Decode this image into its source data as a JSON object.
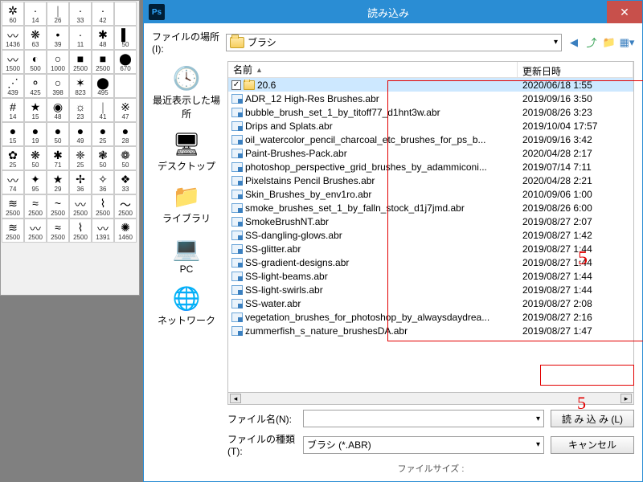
{
  "brush_palette": {
    "cells": [
      {
        "n": "60",
        "g": "✲"
      },
      {
        "n": "14",
        "g": "·"
      },
      {
        "n": "26",
        "g": "｜"
      },
      {
        "n": "33",
        "g": "·"
      },
      {
        "n": "42",
        "g": "·"
      },
      {
        "n": ""
      },
      {
        "n": "1436",
        "g": "〰"
      },
      {
        "n": "63",
        "g": "❋"
      },
      {
        "n": "39",
        "g": "•"
      },
      {
        "n": "11",
        "g": "·"
      },
      {
        "n": "48",
        "g": "✱"
      },
      {
        "n": "50",
        "g": "▌"
      },
      {
        "n": "1500",
        "g": "〰"
      },
      {
        "n": "500",
        "g": "◐"
      },
      {
        "n": "1000",
        "g": "○"
      },
      {
        "n": "2500",
        "g": "■"
      },
      {
        "n": "2500",
        "g": "■"
      },
      {
        "n": "670",
        "g": "⬤"
      },
      {
        "n": "439",
        "g": "⋰"
      },
      {
        "n": "425",
        "g": "⚬"
      },
      {
        "n": "398",
        "g": "○"
      },
      {
        "n": "823",
        "g": "✶"
      },
      {
        "n": "495",
        "g": "⬤"
      },
      {
        "n": ""
      },
      {
        "n": "14",
        "g": "#"
      },
      {
        "n": "15",
        "g": "★"
      },
      {
        "n": "48",
        "g": "◉"
      },
      {
        "n": "23",
        "g": "☼"
      },
      {
        "n": "41",
        "g": "｜"
      },
      {
        "n": "47",
        "g": "※"
      },
      {
        "n": "15",
        "g": "●"
      },
      {
        "n": "19",
        "g": "●"
      },
      {
        "n": "50",
        "g": "●"
      },
      {
        "n": "49",
        "g": "●"
      },
      {
        "n": "25",
        "g": "●"
      },
      {
        "n": "28",
        "g": "●"
      },
      {
        "n": "25",
        "g": "✿"
      },
      {
        "n": "50",
        "g": "❋"
      },
      {
        "n": "71",
        "g": "✱"
      },
      {
        "n": "25",
        "g": "❈"
      },
      {
        "n": "50",
        "g": "❃"
      },
      {
        "n": "50",
        "g": "❁"
      },
      {
        "n": "74",
        "g": "〰"
      },
      {
        "n": "95",
        "g": "✦"
      },
      {
        "n": "29",
        "g": "★"
      },
      {
        "n": "36",
        "g": "✢"
      },
      {
        "n": "36",
        "g": "✧"
      },
      {
        "n": "33",
        "g": "❖"
      },
      {
        "n": "2500",
        "g": "≋"
      },
      {
        "n": "2500",
        "g": "≈"
      },
      {
        "n": "2500",
        "g": "~"
      },
      {
        "n": "2500",
        "g": "〰"
      },
      {
        "n": "2500",
        "g": "⌇"
      },
      {
        "n": "2500",
        "g": "〜"
      },
      {
        "n": "2500",
        "g": "≋"
      },
      {
        "n": "2500",
        "g": "〰"
      },
      {
        "n": "2500",
        "g": "≈"
      },
      {
        "n": "2500",
        "g": "⌇"
      },
      {
        "n": "1391",
        "g": "〰"
      },
      {
        "n": "1460",
        "g": "✺"
      }
    ]
  },
  "dialog": {
    "title": "読み込み",
    "location_label": "ファイルの場所(I):",
    "location_value": "ブラシ",
    "places": [
      {
        "label": "最近表示した場所",
        "icon": "🕓"
      },
      {
        "label": "デスクトップ",
        "icon": "🖥"
      },
      {
        "label": "ライブラリ",
        "icon": "📁"
      },
      {
        "label": "PC",
        "icon": "💻"
      },
      {
        "label": "ネットワーク",
        "icon": "🌐"
      }
    ],
    "headers": {
      "name": "名前",
      "date": "更新日時"
    },
    "files": [
      {
        "type": "folder",
        "checked": true,
        "name": "20.6",
        "date": "2020/06/18 1:55",
        "selected": true
      },
      {
        "type": "abr",
        "name": "ADR_12 High-Res Brushes.abr",
        "date": "2019/09/16 3:50"
      },
      {
        "type": "abr",
        "name": "bubble_brush_set_1_by_titoff77_d1hnt3w.abr",
        "date": "2019/08/26 3:23"
      },
      {
        "type": "abr",
        "name": "Drips and Splats.abr",
        "date": "2019/10/04 17:57"
      },
      {
        "type": "abr",
        "name": "oil_watercolor_pencil_charcoal_etc_brushes_for_ps_b...",
        "date": "2019/09/16 3:42"
      },
      {
        "type": "abr",
        "name": "Paint-Brushes-Pack.abr",
        "date": "2020/04/28 2:17"
      },
      {
        "type": "abr",
        "name": "photoshop_perspective_grid_brushes_by_adammiconi...",
        "date": "2019/07/14 7:11"
      },
      {
        "type": "abr",
        "name": "Pixelstains Pencil Brushes.abr",
        "date": "2020/04/28 2:21"
      },
      {
        "type": "abr",
        "name": "Skin_Brushes_by_env1ro.abr",
        "date": "2010/09/06 1:00"
      },
      {
        "type": "abr",
        "name": "smoke_brushes_set_1_by_falln_stock_d1j7jmd.abr",
        "date": "2019/08/26 6:00"
      },
      {
        "type": "abr",
        "name": "SmokeBrushNT.abr",
        "date": "2019/08/27 2:07"
      },
      {
        "type": "abr",
        "name": "SS-dangling-glows.abr",
        "date": "2019/08/27 1:42"
      },
      {
        "type": "abr",
        "name": "SS-glitter.abr",
        "date": "2019/08/27 1:44"
      },
      {
        "type": "abr",
        "name": "SS-gradient-designs.abr",
        "date": "2019/08/27 1:44"
      },
      {
        "type": "abr",
        "name": "SS-light-beams.abr",
        "date": "2019/08/27 1:44"
      },
      {
        "type": "abr",
        "name": "SS-light-swirls.abr",
        "date": "2019/08/27 1:44"
      },
      {
        "type": "abr",
        "name": "SS-water.abr",
        "date": "2019/08/27 2:08"
      },
      {
        "type": "abr",
        "name": "vegetation_brushes_for_photoshop_by_alwaysdaydrea...",
        "date": "2019/08/27 2:16"
      },
      {
        "type": "abr",
        "name": "zummerfish_s_nature_brushesDA.abr",
        "date": "2019/08/27 1:47"
      }
    ],
    "filename_label": "ファイル名(N):",
    "filename_value": "",
    "filetype_label": "ファイルの種類(T):",
    "filetype_value": "ブラシ (*.ABR)",
    "load_button": "読 み 込 み (L)",
    "cancel_button": "キャンセル",
    "filesize_label": "ファイルサイズ :",
    "annotation": "5"
  }
}
